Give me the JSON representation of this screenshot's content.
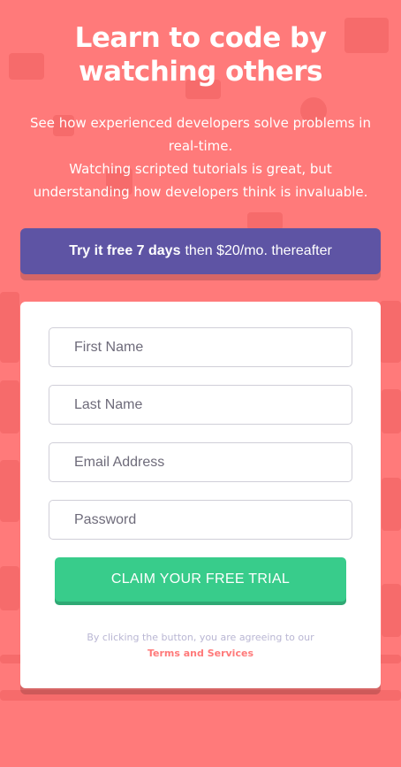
{
  "header": {
    "headline": "Learn to code by watching others",
    "intro_line1": "See how experienced developers solve problems in real-time.",
    "intro_line2": "Watching scripted tutorials is great, but understanding how developers think is invaluable."
  },
  "offer": {
    "bold_text": "Try it free 7 days",
    "rest_text": "then $20/mo. thereafter"
  },
  "form": {
    "first_name_placeholder": "First Name",
    "last_name_placeholder": "Last Name",
    "email_placeholder": "Email Address",
    "password_placeholder": "Password",
    "submit_label": "CLAIM YOUR FREE TRIAL",
    "legal_text": "By clicking the button, you are agreeing to our",
    "terms_link": "Terms and Services"
  },
  "colors": {
    "background": "#ff7a7a",
    "offer_bar": "#5e54a4",
    "cta": "#38cc8b",
    "terms": "#ff7a7a"
  }
}
